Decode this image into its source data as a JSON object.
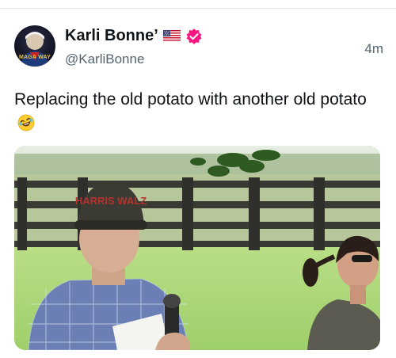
{
  "tweet": {
    "display_name": "Karli Bonne’",
    "handle": "@KarliBonne",
    "time": "4m",
    "text": "Replacing the old potato with another old potato",
    "avatar_text": "MAGA WAY"
  },
  "media": {
    "cap_text": "HARRIS WALZ"
  },
  "colors": {
    "verified": "#f91880",
    "secondary_text": "#536471",
    "primary_text": "#0f1419"
  }
}
